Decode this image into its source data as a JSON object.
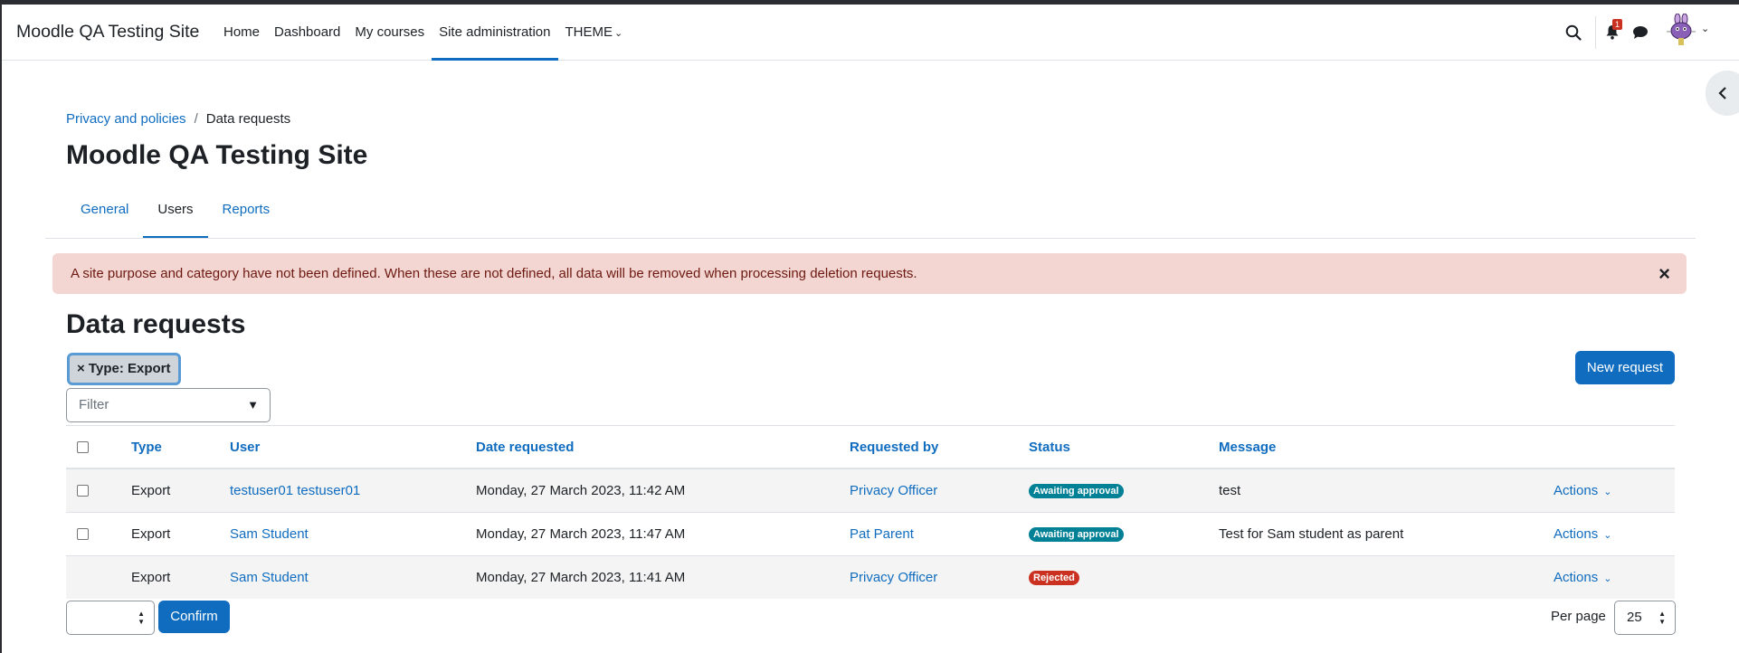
{
  "navbar": {
    "brand": "Moodle QA Testing Site",
    "items": [
      {
        "label": "Home"
      },
      {
        "label": "Dashboard"
      },
      {
        "label": "My courses"
      },
      {
        "label": "Site administration"
      },
      {
        "label": "THEME"
      }
    ],
    "notification_count": "1"
  },
  "breadcrumb": {
    "parent": "Privacy and policies",
    "separator": "/",
    "current": "Data requests"
  },
  "page_title": "Moodle QA Testing Site",
  "secondary_tabs": [
    {
      "label": "General"
    },
    {
      "label": "Users"
    },
    {
      "label": "Reports"
    }
  ],
  "alert": {
    "message": "A site purpose and category have not been defined. When these are not defined, all data will be removed when processing deletion requests.",
    "close": "×"
  },
  "section_title": "Data requests",
  "filter": {
    "chip": "× Type: Export",
    "placeholder": "Filter",
    "caret": "▼"
  },
  "new_request_label": "New request",
  "table": {
    "headers": {
      "type": "Type",
      "user": "User",
      "date": "Date requested",
      "requested_by": "Requested by",
      "status": "Status",
      "message": "Message"
    },
    "rows": [
      {
        "type": "Export",
        "user": "testuser01 testuser01",
        "date": "Monday, 27 March 2023, 11:42 AM",
        "requested_by": "Privacy Officer",
        "status": "Awaiting approval",
        "message": "test",
        "actions": "Actions"
      },
      {
        "type": "Export",
        "user": "Sam Student",
        "date": "Monday, 27 March 2023, 11:47 AM",
        "requested_by": "Pat Parent",
        "status": "Awaiting approval",
        "message": "Test for Sam student as parent",
        "actions": "Actions"
      },
      {
        "type": "Export",
        "user": "Sam Student",
        "date": "Monday, 27 March 2023, 11:41 AM",
        "requested_by": "Privacy Officer",
        "status": "Rejected",
        "message": "",
        "actions": "Actions"
      }
    ]
  },
  "footer": {
    "confirm_label": "Confirm",
    "per_page_label": "Per page",
    "per_page_value": "25"
  },
  "colors": {
    "primary": "#0f6cbf",
    "awaiting": "#008196",
    "rejected": "#ca3120",
    "alert_bg": "#f3d5d2"
  }
}
